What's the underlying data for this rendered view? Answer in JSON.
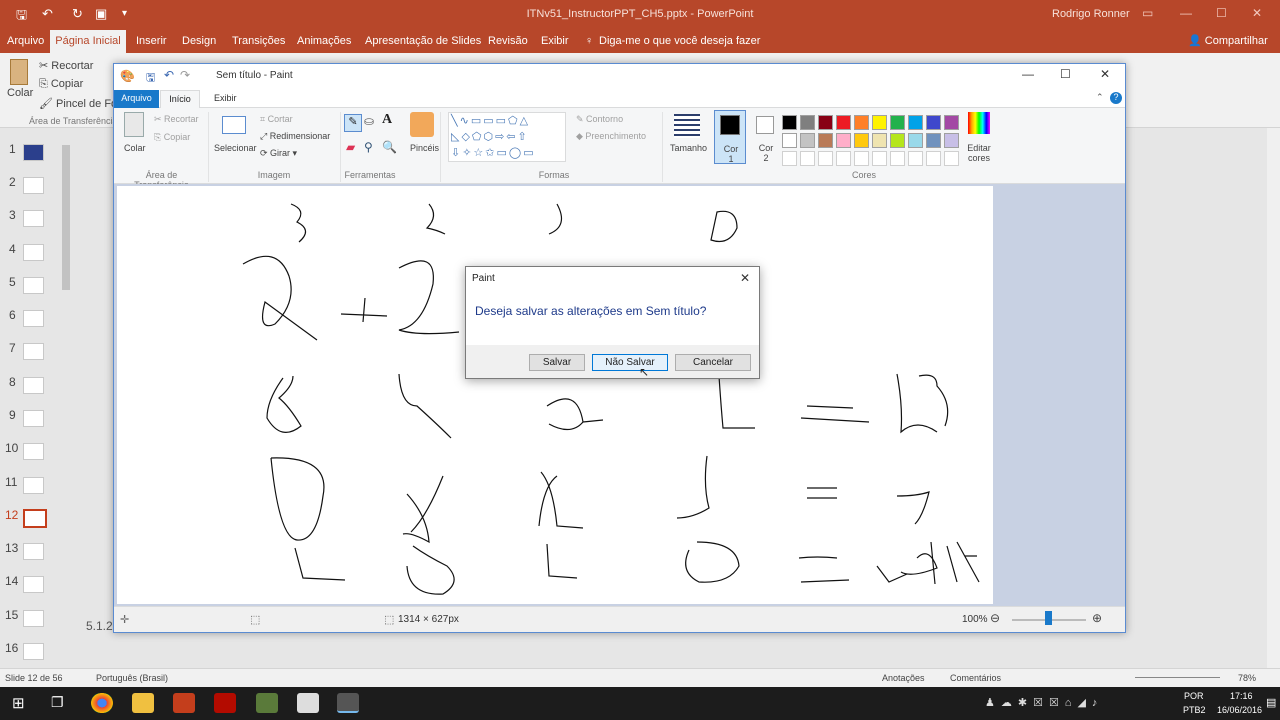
{
  "powerpoint": {
    "window_title": "ITNv51_InstructorPPT_CH5.pptx - PowerPoint",
    "user": "Rodrigo Ronner",
    "tabs": [
      "Arquivo",
      "Página Inicial",
      "Inserir",
      "Design",
      "Transições",
      "Animações",
      "Apresentação de Slides",
      "Revisão",
      "Exibir"
    ],
    "tell_me": "Diga-me o que você deseja fazer",
    "share": "Compartilhar",
    "ribbon": {
      "paste": "Colar",
      "cut": "Recortar",
      "copy": "Copiar",
      "format_painter": "Pincel de Formatação",
      "clipboard_group": "Área de Transferência"
    },
    "slides": [
      "1",
      "2",
      "3",
      "4",
      "5",
      "6",
      "7",
      "8",
      "9",
      "10",
      "11",
      "12",
      "13",
      "14",
      "15",
      "16"
    ],
    "active_slide": "12",
    "slide_label": "5.1.2.",
    "status": {
      "slide_info": "Slide 12 de 56",
      "language": "Português (Brasil)",
      "notes": "Anotações",
      "comments": "Comentários",
      "zoom": "78%"
    }
  },
  "paint": {
    "title": "Sem título - Paint",
    "tabs": {
      "file": "Arquivo",
      "home": "Início",
      "view": "Exibir"
    },
    "clipboard": {
      "paste": "Colar",
      "cut": "Recortar",
      "copy": "Copiar",
      "group": "Área de Transferência"
    },
    "image": {
      "select": "Selecionar",
      "crop": "Cortar",
      "resize": "Redimensionar",
      "rotate": "Girar",
      "group": "Imagem"
    },
    "tools_group": "Ferramentas",
    "brushes": "Pincéis",
    "shapes": {
      "outline": "Contorno",
      "fill": "Preenchimento",
      "group": "Formas"
    },
    "size": "Tamanho",
    "color1": "Cor 1",
    "color2": "Cor 2",
    "edit_colors": "Editar cores",
    "colors_group": "Cores",
    "palette_row1": [
      "#000000",
      "#7f7f7f",
      "#880015",
      "#ed1c24",
      "#ff7f27",
      "#fff200",
      "#22b14c",
      "#00a2e8",
      "#3f48cc",
      "#a349a4"
    ],
    "palette_row2": [
      "#ffffff",
      "#c3c3c3",
      "#b97a57",
      "#ffaec9",
      "#ffc90e",
      "#efe4b0",
      "#b5e61d",
      "#99d9ea",
      "#7092be",
      "#c8bfe7"
    ],
    "status": {
      "dimensions": "1314 × 627px",
      "zoom": "100%"
    }
  },
  "dialog": {
    "title": "Paint",
    "message": "Deseja salvar as alterações em Sem título?",
    "save": "Salvar",
    "dont_save": "Não Salvar",
    "cancel": "Cancelar"
  },
  "taskbar": {
    "lang1": "POR",
    "lang2": "PTB2",
    "time": "17:16",
    "date": "16/06/2016"
  }
}
